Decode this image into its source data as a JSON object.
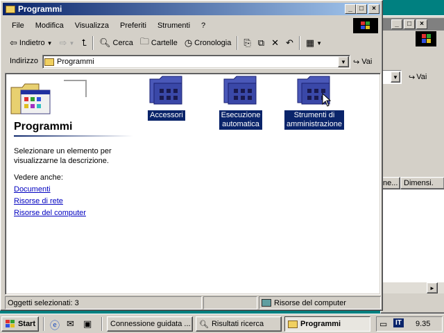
{
  "background_window": {
    "col_name_partial": "ne...",
    "col_size": "Dimensi.",
    "go_label": "Vai"
  },
  "window": {
    "title": "Programmi",
    "min_glyph": "_",
    "max_glyph": "□",
    "close_glyph": "×"
  },
  "menu": {
    "file": "File",
    "edit": "Modifica",
    "view": "Visualizza",
    "favorites": "Preferiti",
    "tools": "Strumenti",
    "help": "?"
  },
  "toolbar": {
    "back": "Indietro",
    "search": "Cerca",
    "folders": "Cartelle",
    "history": "Cronologia"
  },
  "address": {
    "label": "Indirizzo",
    "value": "Programmi",
    "go": "Vai"
  },
  "left_panel": {
    "title": "Programmi",
    "description": [
      "Selezionare un elemento per",
      "visualizzarne la descrizione."
    ],
    "see_also": "Vedere anche:",
    "links": [
      "Documenti",
      "Risorse di rete",
      "Risorse del computer"
    ]
  },
  "folders": [
    {
      "line1": "Accessori",
      "line2": ""
    },
    {
      "line1": "Esecuzione",
      "line2": "automatica"
    },
    {
      "line1": "Strumenti di",
      "line2": "amministrazione"
    }
  ],
  "status": {
    "selected": "Oggetti selezionati: 3",
    "location": "Risorse del computer"
  },
  "taskbar": {
    "start": "Start",
    "tasks": [
      "Connessione guidata ...",
      "Risultati ricerca",
      "Programmi"
    ],
    "lang": "IT",
    "clock": "9.35"
  },
  "colors": {
    "title_active": "#0a246a",
    "title_inactive": "#808080",
    "desktop": "#008080",
    "link": "#0000c0",
    "selection": "#0a246a"
  }
}
